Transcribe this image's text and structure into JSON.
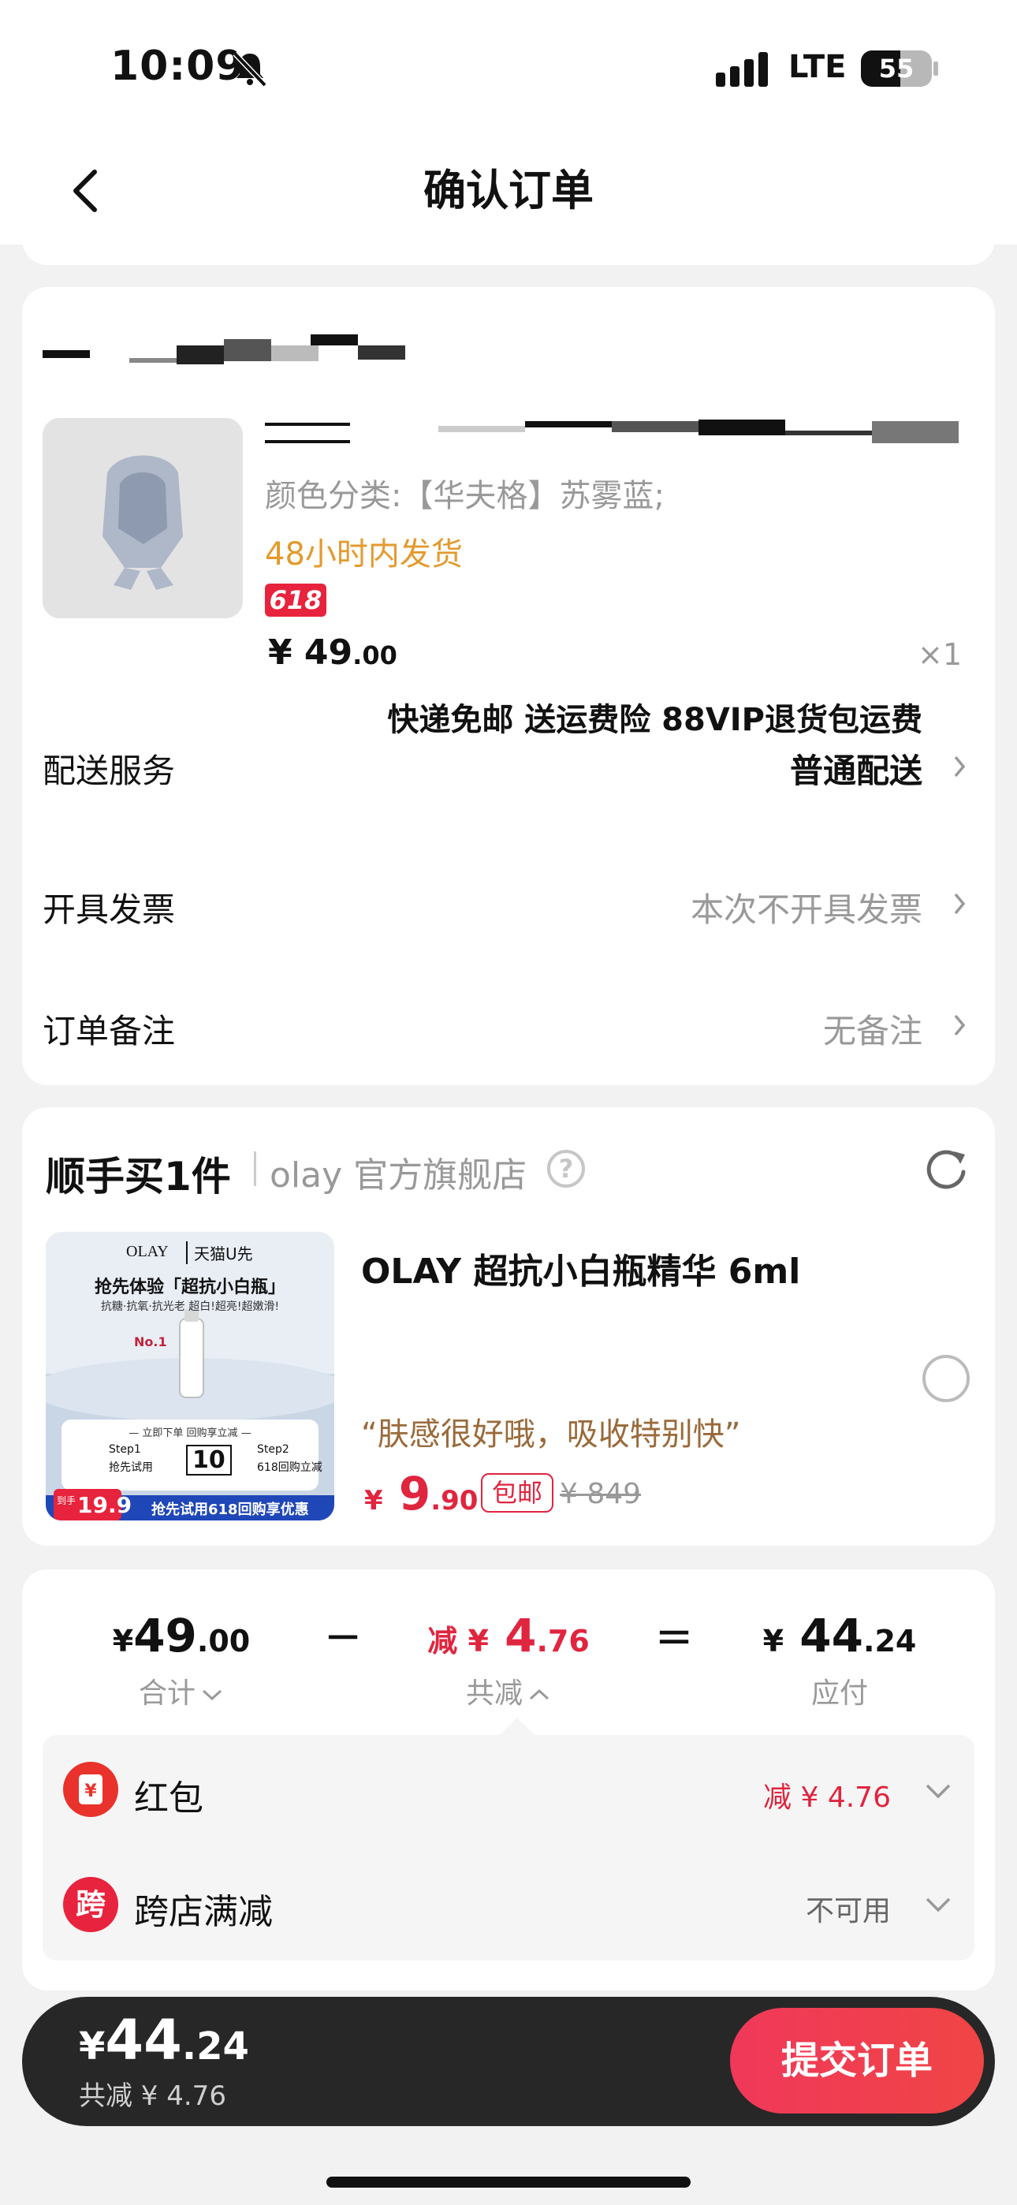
{
  "status_bar": {
    "time": "10:09",
    "network": "LTE",
    "battery": "55",
    "battery_level": 0.55
  },
  "header": {
    "title": "确认订单"
  },
  "order": {
    "sku": "颜色分类:【华夫格】苏雾蓝;",
    "shipping_tip": "48小时内发货",
    "badge": "618",
    "price_main": "¥ 49",
    "price_decimal": ".00",
    "quantity": "×1",
    "delivery": {
      "label": "配送服务",
      "note": "快递免邮 送运费险 88VIP退货包运费",
      "value": "普通配送"
    },
    "invoice": {
      "label": "开具发票",
      "value": "本次不开具发票"
    },
    "remark": {
      "label": "订单备注",
      "value": "无备注"
    }
  },
  "upsell": {
    "title": "顺手买1件",
    "store": "olay 官方旗舰店",
    "help": "?",
    "product_name": "OLAY 超抗小白瓶精华 6ml",
    "quote": "“肤感很好哦，吸收特别快”",
    "price_currency": "¥",
    "price_main": "9",
    "price_decimal": ".90",
    "free_shipping": "包邮",
    "original_price": "¥ 849",
    "image": {
      "brand": "OLAY",
      "channel": "天猫U先",
      "headline": "抢先体验「超抗小白瓶」",
      "subline": "抗糖·抗氧·抗光老 超白!超亮!超嫩滑!",
      "no1": "No.1",
      "steps_header": "— 立即下单 回购享立减 —",
      "step1": "Step1",
      "step1_text": "抢先试用",
      "step2": "Step2",
      "step2_text": "618回购立减",
      "coupon": "10",
      "price_tag_prefix": "到手",
      "price_tag": "19.9",
      "footer": "抢先试用618回购享优惠"
    }
  },
  "summary": {
    "total": {
      "currency": "¥",
      "main": "49",
      "decimal": ".00",
      "label": "合计"
    },
    "minus": "−",
    "discount": {
      "prefix": "减 ¥",
      "main": " 4",
      "decimal": ".76",
      "label": "共减"
    },
    "equals": "=",
    "payable": {
      "currency": "¥",
      "main": " 44",
      "decimal": ".24",
      "label": "应付"
    },
    "hongbao": {
      "icon": "¥",
      "label": "红包",
      "value": "减 ¥ 4.76"
    },
    "crossstore": {
      "icon": "跨",
      "label": "跨店满减",
      "value": "不可用"
    }
  },
  "bottom_bar": {
    "currency": "¥",
    "total_main": "44",
    "total_decimal": ".24",
    "discount_text": "共减 ¥ 4.76",
    "submit": "提交订单"
  },
  "colors": {
    "accent": "#e0253f",
    "orange": "#e39a2e",
    "quote": "#9a6a3a",
    "bar": "#272727"
  }
}
